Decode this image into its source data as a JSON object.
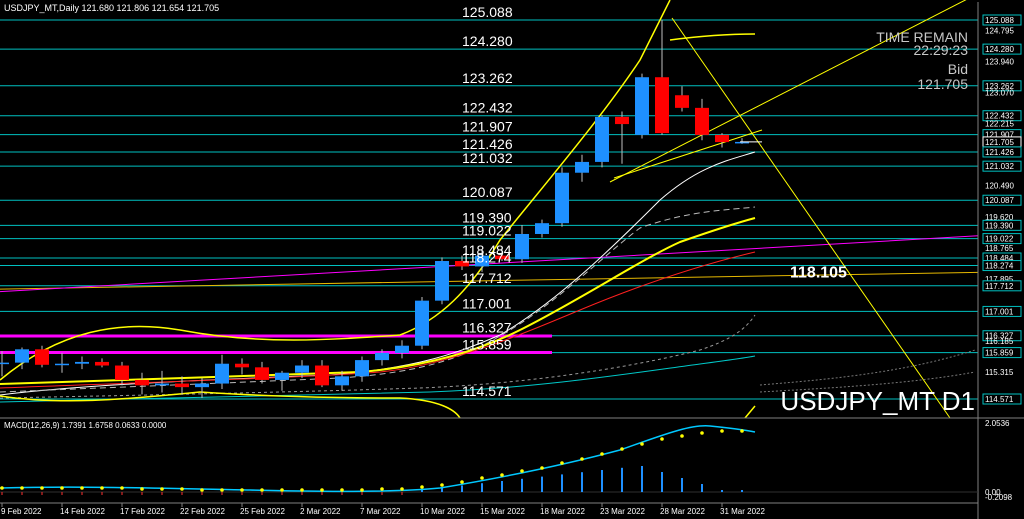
{
  "header": {
    "symbol_info": "USDJPY_MT,Daily  121.680 121.806 121.654 121.705"
  },
  "overlay": {
    "time_remain_label": "TIME REMAIN",
    "time_remain_value": "22:29:23",
    "bid_label": "Bid",
    "bid_value": "121.705"
  },
  "watermark": "USDJPY_MT D1",
  "macd_label": "MACD(12,26,9) 1.7391 1.6758 0.0633 0.0000",
  "colors": {
    "background": "#000000",
    "bull": "#1e90ff",
    "bear": "#ff0000",
    "level_line": "#00c0c0",
    "yellow": "#ffff00",
    "magenta": "#ff00ff",
    "macd_line": "#00c8ff",
    "macd_signal": "#ffff00"
  },
  "level_labels": [
    {
      "price": 125.088,
      "text": "125.088"
    },
    {
      "price": 124.28,
      "text": "124.280"
    },
    {
      "price": 123.262,
      "text": "123.262"
    },
    {
      "price": 122.432,
      "text": "122.432"
    },
    {
      "price": 121.907,
      "text": "121.907"
    },
    {
      "price": 121.426,
      "text": "121.426"
    },
    {
      "price": 121.032,
      "text": "121.032"
    },
    {
      "price": 120.087,
      "text": "120.087"
    },
    {
      "price": 119.39,
      "text": "119.390"
    },
    {
      "price": 119.022,
      "text": "119.022"
    },
    {
      "price": 118.484,
      "text": "118.484"
    },
    {
      "price": 118.274,
      "text": "118.274"
    },
    {
      "price": 117.712,
      "text": "117.712"
    },
    {
      "price": 117.001,
      "text": "117.001"
    },
    {
      "price": 116.327,
      "text": "116.327"
    },
    {
      "price": 115.859,
      "text": "115.859"
    },
    {
      "price": 114.571,
      "text": "114.571"
    }
  ],
  "trend_label": {
    "price": 118.105,
    "text": "118.105"
  },
  "price_scale": [
    {
      "price": 125.088,
      "text": "125.088",
      "boxed": true
    },
    {
      "price": 124.795,
      "text": "124.795",
      "boxed": false
    },
    {
      "price": 124.28,
      "text": "124.280",
      "boxed": true
    },
    {
      "price": 123.94,
      "text": "123.940",
      "boxed": false
    },
    {
      "price": 123.262,
      "text": "123.262",
      "boxed": true
    },
    {
      "price": 123.07,
      "text": "123.070",
      "boxed": false
    },
    {
      "price": 122.432,
      "text": "122.432",
      "boxed": true
    },
    {
      "price": 122.215,
      "text": "122.215",
      "boxed": false
    },
    {
      "price": 121.907,
      "text": "121.907",
      "boxed": true
    },
    {
      "price": 121.705,
      "text": "121.705",
      "boxed": true,
      "bid": true
    },
    {
      "price": 121.426,
      "text": "121.426",
      "boxed": true
    },
    {
      "price": 121.032,
      "text": "121.032",
      "boxed": true
    },
    {
      "price": 120.49,
      "text": "120.490",
      "boxed": false
    },
    {
      "price": 120.087,
      "text": "120.087",
      "boxed": true
    },
    {
      "price": 119.62,
      "text": "119.620",
      "boxed": false
    },
    {
      "price": 119.39,
      "text": "119.390",
      "boxed": true
    },
    {
      "price": 119.022,
      "text": "119.022",
      "boxed": true
    },
    {
      "price": 118.765,
      "text": "118.765",
      "boxed": false
    },
    {
      "price": 118.484,
      "text": "118.484",
      "boxed": true
    },
    {
      "price": 118.274,
      "text": "118.274",
      "boxed": true
    },
    {
      "price": 117.895,
      "text": "117.895",
      "boxed": false
    },
    {
      "price": 117.712,
      "text": "117.712",
      "boxed": true
    },
    {
      "price": 117.001,
      "text": "117.001",
      "boxed": true
    },
    {
      "price": 116.327,
      "text": "116.327",
      "boxed": true
    },
    {
      "price": 116.185,
      "text": "116.185",
      "boxed": false
    },
    {
      "price": 115.859,
      "text": "115.859",
      "boxed": true
    },
    {
      "price": 115.315,
      "text": "115.315",
      "boxed": false
    },
    {
      "price": 114.571,
      "text": "114.571",
      "boxed": true
    }
  ],
  "macd_scale": [
    "2.0536",
    "0.00",
    "-0.2098"
  ],
  "date_labels": [
    "9 Feb 2022",
    "14 Feb 2022",
    "17 Feb 2022",
    "22 Feb 2022",
    "25 Feb 2022",
    "2 Mar 2022",
    "7 Mar 2022",
    "10 Mar 2022",
    "15 Mar 2022",
    "18 Mar 2022",
    "23 Mar 2022",
    "28 Mar 2022",
    "31 Mar 2022"
  ],
  "chart_data": {
    "type": "candlestick",
    "candles": [
      {
        "o": 115.55,
        "h": 115.9,
        "l": 115.2,
        "c": 115.58
      },
      {
        "o": 115.58,
        "h": 116.0,
        "l": 115.4,
        "c": 115.95
      },
      {
        "o": 115.95,
        "h": 116.05,
        "l": 115.45,
        "c": 115.52
      },
      {
        "o": 115.52,
        "h": 115.85,
        "l": 115.3,
        "c": 115.55
      },
      {
        "o": 115.55,
        "h": 115.75,
        "l": 115.4,
        "c": 115.6
      },
      {
        "o": 115.6,
        "h": 115.7,
        "l": 115.45,
        "c": 115.5
      },
      {
        "o": 115.5,
        "h": 115.6,
        "l": 114.95,
        "c": 115.1
      },
      {
        "o": 115.1,
        "h": 115.3,
        "l": 114.7,
        "c": 114.95
      },
      {
        "o": 114.95,
        "h": 115.35,
        "l": 114.75,
        "c": 115.0
      },
      {
        "o": 115.0,
        "h": 115.2,
        "l": 114.7,
        "c": 114.9
      },
      {
        "o": 114.9,
        "h": 115.15,
        "l": 114.6,
        "c": 115.0
      },
      {
        "o": 115.0,
        "h": 115.8,
        "l": 114.85,
        "c": 115.55
      },
      {
        "o": 115.55,
        "h": 115.7,
        "l": 115.25,
        "c": 115.45
      },
      {
        "o": 115.45,
        "h": 115.6,
        "l": 115.0,
        "c": 115.1
      },
      {
        "o": 115.1,
        "h": 115.35,
        "l": 114.8,
        "c": 115.3
      },
      {
        "o": 115.3,
        "h": 115.65,
        "l": 115.15,
        "c": 115.5
      },
      {
        "o": 115.5,
        "h": 115.65,
        "l": 114.9,
        "c": 114.95
      },
      {
        "o": 114.95,
        "h": 115.35,
        "l": 114.8,
        "c": 115.2
      },
      {
        "o": 115.2,
        "h": 115.75,
        "l": 115.05,
        "c": 115.65
      },
      {
        "o": 115.65,
        "h": 115.95,
        "l": 115.5,
        "c": 115.85
      },
      {
        "o": 115.85,
        "h": 116.2,
        "l": 115.7,
        "c": 116.05
      },
      {
        "o": 116.05,
        "h": 117.4,
        "l": 115.95,
        "c": 117.3
      },
      {
        "o": 117.3,
        "h": 118.5,
        "l": 117.2,
        "c": 118.4
      },
      {
        "o": 118.4,
        "h": 118.55,
        "l": 118.15,
        "c": 118.25
      },
      {
        "o": 118.25,
        "h": 118.7,
        "l": 118.1,
        "c": 118.55
      },
      {
        "o": 118.55,
        "h": 118.8,
        "l": 118.4,
        "c": 118.45
      },
      {
        "o": 118.45,
        "h": 119.4,
        "l": 118.35,
        "c": 119.15
      },
      {
        "o": 119.15,
        "h": 119.55,
        "l": 119.05,
        "c": 119.45
      },
      {
        "o": 119.45,
        "h": 121.0,
        "l": 119.35,
        "c": 120.85
      },
      {
        "o": 120.85,
        "h": 121.35,
        "l": 120.6,
        "c": 121.15
      },
      {
        "o": 121.15,
        "h": 122.45,
        "l": 121.0,
        "c": 122.4
      },
      {
        "o": 122.4,
        "h": 122.55,
        "l": 121.1,
        "c": 122.2
      },
      {
        "o": 121.9,
        "h": 123.6,
        "l": 121.8,
        "c": 123.5
      },
      {
        "o": 123.5,
        "h": 125.09,
        "l": 121.9,
        "c": 121.95
      },
      {
        "o": 123.0,
        "h": 123.25,
        "l": 122.55,
        "c": 122.65
      },
      {
        "o": 122.65,
        "h": 122.9,
        "l": 121.75,
        "c": 121.9
      },
      {
        "o": 121.9,
        "h": 121.95,
        "l": 121.55,
        "c": 121.7
      },
      {
        "o": 121.68,
        "h": 121.81,
        "l": 121.65,
        "c": 121.705
      }
    ]
  }
}
